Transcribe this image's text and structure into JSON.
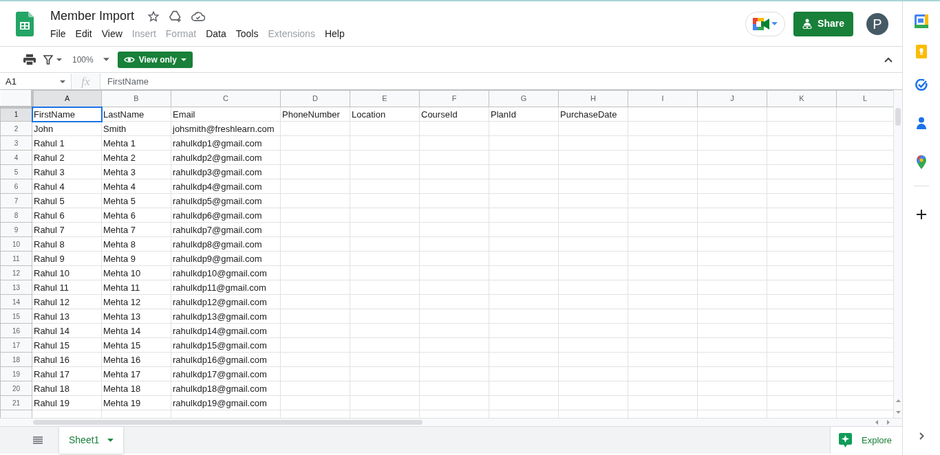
{
  "document": {
    "title": "Member Import"
  },
  "menu": [
    {
      "label": "File",
      "disabled": false
    },
    {
      "label": "Edit",
      "disabled": false
    },
    {
      "label": "View",
      "disabled": false
    },
    {
      "label": "Insert",
      "disabled": true
    },
    {
      "label": "Format",
      "disabled": true
    },
    {
      "label": "Data",
      "disabled": false
    },
    {
      "label": "Tools",
      "disabled": false
    },
    {
      "label": "Extensions",
      "disabled": true
    },
    {
      "label": "Help",
      "disabled": false
    }
  ],
  "share_button": {
    "label": "Share"
  },
  "account": {
    "initial": "P"
  },
  "toolbar": {
    "zoom": "100%",
    "mode_button": "View only"
  },
  "formula_bar": {
    "cell_ref": "A1",
    "fx": "fx",
    "value": "FirstName"
  },
  "columns": [
    {
      "label": "A",
      "selected": true
    },
    {
      "label": "B",
      "selected": false
    },
    {
      "label": "C",
      "selected": false
    },
    {
      "label": "D",
      "selected": false
    },
    {
      "label": "E",
      "selected": false
    },
    {
      "label": "F",
      "selected": false
    },
    {
      "label": "G",
      "selected": false
    },
    {
      "label": "H",
      "selected": false
    },
    {
      "label": "I",
      "selected": false
    },
    {
      "label": "J",
      "selected": false
    },
    {
      "label": "K",
      "selected": false
    },
    {
      "label": "L",
      "selected": false
    }
  ],
  "rows": [
    {
      "number": "1",
      "selected": true,
      "cells": [
        "FirstName",
        "LastName",
        "Email",
        "PhoneNumber",
        "Location",
        "CourseId",
        "PlanId",
        "PurchaseDate"
      ]
    },
    {
      "number": "2",
      "selected": false,
      "cells": [
        "John",
        "Smith",
        "johsmith@freshlearn.com"
      ]
    },
    {
      "number": "3",
      "selected": false,
      "cells": [
        "Rahul 1",
        "Mehta 1",
        "rahulkdp1@gmail.com"
      ]
    },
    {
      "number": "4",
      "selected": false,
      "cells": [
        "Rahul 2",
        "Mehta 2",
        "rahulkdp2@gmail.com"
      ]
    },
    {
      "number": "5",
      "selected": false,
      "cells": [
        "Rahul 3",
        "Mehta 3",
        "rahulkdp3@gmail.com"
      ]
    },
    {
      "number": "6",
      "selected": false,
      "cells": [
        "Rahul 4",
        "Mehta 4",
        "rahulkdp4@gmail.com"
      ]
    },
    {
      "number": "7",
      "selected": false,
      "cells": [
        "Rahul 5",
        "Mehta 5",
        "rahulkdp5@gmail.com"
      ]
    },
    {
      "number": "8",
      "selected": false,
      "cells": [
        "Rahul 6",
        "Mehta 6",
        "rahulkdp6@gmail.com"
      ]
    },
    {
      "number": "9",
      "selected": false,
      "cells": [
        "Rahul 7",
        "Mehta 7",
        "rahulkdp7@gmail.com"
      ]
    },
    {
      "number": "10",
      "selected": false,
      "cells": [
        "Rahul 8",
        "Mehta 8",
        "rahulkdp8@gmail.com"
      ]
    },
    {
      "number": "11",
      "selected": false,
      "cells": [
        "Rahul 9",
        "Mehta 9",
        "rahulkdp9@gmail.com"
      ]
    },
    {
      "number": "12",
      "selected": false,
      "cells": [
        "Rahul 10",
        "Mehta 10",
        "rahulkdp10@gmail.com"
      ]
    },
    {
      "number": "13",
      "selected": false,
      "cells": [
        "Rahul 11",
        "Mehta 11",
        "rahulkdp11@gmail.com"
      ]
    },
    {
      "number": "14",
      "selected": false,
      "cells": [
        "Rahul 12",
        "Mehta 12",
        "rahulkdp12@gmail.com"
      ]
    },
    {
      "number": "15",
      "selected": false,
      "cells": [
        "Rahul 13",
        "Mehta 13",
        "rahulkdp13@gmail.com"
      ]
    },
    {
      "number": "16",
      "selected": false,
      "cells": [
        "Rahul 14",
        "Mehta 14",
        "rahulkdp14@gmail.com"
      ]
    },
    {
      "number": "17",
      "selected": false,
      "cells": [
        "Rahul 15",
        "Mehta 15",
        "rahulkdp15@gmail.com"
      ]
    },
    {
      "number": "18",
      "selected": false,
      "cells": [
        "Rahul 16",
        "Mehta 16",
        "rahulkdp16@gmail.com"
      ]
    },
    {
      "number": "19",
      "selected": false,
      "cells": [
        "Rahul 17",
        "Mehta 17",
        "rahulkdp17@gmail.com"
      ]
    },
    {
      "number": "20",
      "selected": false,
      "cells": [
        "Rahul 18",
        "Mehta 18",
        "rahulkdp18@gmail.com"
      ]
    },
    {
      "number": "21",
      "selected": false,
      "cells": [
        "Rahul 19",
        "Mehta 19",
        "rahulkdp19@gmail.com"
      ]
    }
  ],
  "sheet_tabs": [
    {
      "label": "Sheet1",
      "selected": true
    }
  ],
  "explore_button": {
    "label": "Explore"
  }
}
